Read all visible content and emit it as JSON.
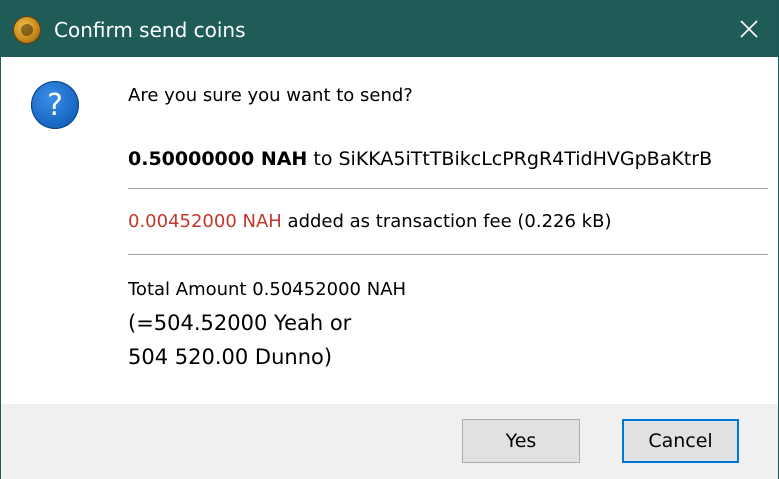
{
  "window": {
    "title": "Confirm send coins",
    "close_symbol": "✕"
  },
  "icons": {
    "app": "coin-app-icon",
    "question": "question-icon",
    "question_glyph": "?"
  },
  "message": {
    "question": "Are you sure you want to send?",
    "amount": "0.50000000 NAH",
    "to_word": " to ",
    "address": "SiKKA5iTtTBikcLcPRgR4TidHVGpBaKtrB",
    "fee_amount": "0.00452000 NAH",
    "fee_text": " added as transaction fee (0.226 kB)",
    "total_line1": "Total Amount 0.50452000 NAH",
    "total_line2": "(=504.52000 Yeah or",
    "total_line3": "504 520.00 Dunno)"
  },
  "buttons": {
    "yes": "Yes",
    "cancel": "Cancel"
  },
  "colors": {
    "titlebar": "#1f5b57",
    "fee_red": "#c0392b",
    "focus_blue": "#0078d7"
  }
}
